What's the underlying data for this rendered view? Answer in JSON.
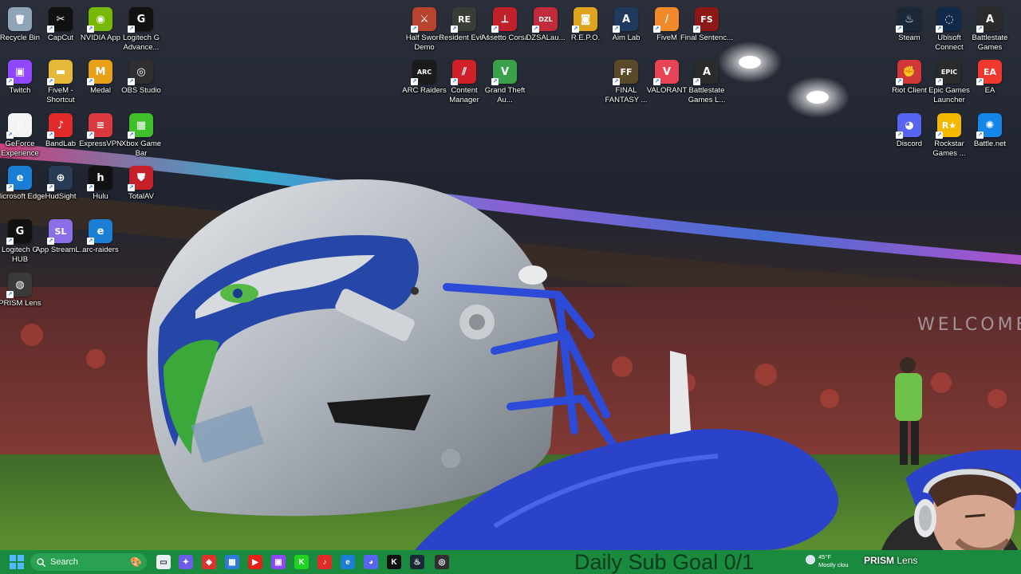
{
  "desktop": {
    "icons": [
      {
        "id": "recycle-bin",
        "label": "Recycle Bin",
        "glyph": "🗑",
        "bg": "#8fa4b8",
        "shortcut": false
      },
      {
        "id": "capcut",
        "label": "CapCut",
        "glyph": "✂",
        "bg": "#111111",
        "shortcut": true
      },
      {
        "id": "nvidia-app",
        "label": "NVIDIA App",
        "glyph": "◉",
        "bg": "#76b900",
        "shortcut": true
      },
      {
        "id": "logitech-g-advance",
        "label": "Logitech G Advance...",
        "glyph": "G",
        "bg": "#111111",
        "shortcut": true
      },
      {
        "id": "twitch",
        "label": "Twitch",
        "glyph": "▣",
        "bg": "#9146ff",
        "shortcut": true
      },
      {
        "id": "fivem-shortcut",
        "label": "FiveM - Shortcut",
        "glyph": "▬",
        "bg": "#e8b83a",
        "shortcut": true
      },
      {
        "id": "medal",
        "label": "Medal",
        "glyph": "M",
        "bg": "#e8a017",
        "shortcut": true
      },
      {
        "id": "obs-studio",
        "label": "OBS Studio",
        "glyph": "◎",
        "bg": "#302e31",
        "shortcut": true
      },
      {
        "id": "geforce-experience",
        "label": "GeForce Experience",
        "glyph": "▯",
        "bg": "#f4f4f4",
        "shortcut": true
      },
      {
        "id": "bandlab",
        "label": "BandLab",
        "glyph": "♪",
        "bg": "#e22a2a",
        "shortcut": true
      },
      {
        "id": "expressvpn",
        "label": "ExpressVPN",
        "glyph": "≡",
        "bg": "#da3940",
        "shortcut": true
      },
      {
        "id": "xbox-game-bar",
        "label": "Xbox Game Bar",
        "glyph": "▦",
        "bg": "#3fbf2a",
        "shortcut": true
      },
      {
        "id": "microsoft-edge",
        "label": "Microsoft Edge",
        "glyph": "e",
        "bg": "#1a7fd4",
        "shortcut": true
      },
      {
        "id": "hudsight",
        "label": "HudSight",
        "glyph": "⊕",
        "bg": "#2a3c55",
        "shortcut": true
      },
      {
        "id": "hulu",
        "label": "Hulu",
        "glyph": "h",
        "bg": "#111111",
        "shortcut": true
      },
      {
        "id": "totalav",
        "label": "TotalAV",
        "glyph": "⛊",
        "bg": "#c6202a",
        "shortcut": true
      },
      {
        "id": "logitech-g-hub",
        "label": "Logitech G HUB",
        "glyph": "G",
        "bg": "#111111",
        "shortcut": true
      },
      {
        "id": "app-streamlabs",
        "label": "App StreamL...",
        "glyph": "SL",
        "bg": "#8a6fe8",
        "shortcut": true
      },
      {
        "id": "arc-raiders-edge",
        "label": "arc-raiders",
        "glyph": "e",
        "bg": "#1a7fd4",
        "shortcut": true
      },
      {
        "id": "prism-lens",
        "label": "PRISM Lens",
        "glyph": "◍",
        "bg": "#3a3a3a",
        "shortcut": true
      },
      {
        "id": "half-sword-demo",
        "label": "Half Sword Demo",
        "glyph": "⚔",
        "bg": "#b9432e",
        "shortcut": true
      },
      {
        "id": "resident-evil-4",
        "label": "Resident Evil 4",
        "glyph": "RE",
        "bg": "#3a3d36",
        "shortcut": true
      },
      {
        "id": "assetto-corsa",
        "label": "Assetto Corsa",
        "glyph": "⟂",
        "bg": "#c0202a",
        "shortcut": true
      },
      {
        "id": "dzsa-launcher",
        "label": "DZSALau...",
        "glyph": "DZL",
        "bg": "#c12b3a",
        "shortcut": true
      },
      {
        "id": "repo",
        "label": "R.E.P.O.",
        "glyph": "◙",
        "bg": "#e0a31c",
        "shortcut": true
      },
      {
        "id": "aim-lab",
        "label": "Aim Lab",
        "glyph": "A",
        "bg": "#1f3a5c",
        "shortcut": true
      },
      {
        "id": "fivem",
        "label": "FiveM",
        "glyph": "/",
        "bg": "#f28a2c",
        "shortcut": true
      },
      {
        "id": "final-sentence",
        "label": "Final Sentenc...",
        "glyph": "FS",
        "bg": "#8c1818",
        "shortcut": true
      },
      {
        "id": "arc-raiders",
        "label": "ARC Raiders",
        "glyph": "ARC",
        "bg": "#1b1b1b",
        "shortcut": true
      },
      {
        "id": "content-manager",
        "label": "Content Manager",
        "glyph": "⫽",
        "bg": "#d0202a",
        "shortcut": true
      },
      {
        "id": "gta-v",
        "label": "Grand Theft Au...",
        "glyph": "V",
        "bg": "#3aa14a",
        "shortcut": true
      },
      {
        "id": "final-fantasy",
        "label": "FINAL FANTASY ...",
        "glyph": "FF",
        "bg": "#5a4a2a",
        "shortcut": true
      },
      {
        "id": "valorant",
        "label": "VALORANT",
        "glyph": "V",
        "bg": "#e84456",
        "shortcut": true
      },
      {
        "id": "battlestate-games-launcher",
        "label": "Battlestate Games L...",
        "glyph": "A",
        "bg": "#2b2b2b",
        "shortcut": true
      },
      {
        "id": "steam",
        "label": "Steam",
        "glyph": "♨",
        "bg": "#1b2838",
        "shortcut": true
      },
      {
        "id": "ubisoft-connect",
        "label": "Ubisoft Connect",
        "glyph": "◌",
        "bg": "#0f2a4a",
        "shortcut": true
      },
      {
        "id": "battlestate-games",
        "label": "Battlestate Games",
        "glyph": "A",
        "bg": "#2b2b2b",
        "shortcut": true
      },
      {
        "id": "riot-client",
        "label": "Riot Client",
        "glyph": "✊",
        "bg": "#d13639",
        "shortcut": true
      },
      {
        "id": "epic-games-launcher",
        "label": "Epic Games Launcher",
        "glyph": "EPIC",
        "bg": "#2a2a2a",
        "shortcut": true
      },
      {
        "id": "ea",
        "label": "EA",
        "glyph": "EA",
        "bg": "#f0382e",
        "shortcut": true
      },
      {
        "id": "discord",
        "label": "Discord",
        "glyph": "◕",
        "bg": "#5865f2",
        "shortcut": true
      },
      {
        "id": "rockstar-games",
        "label": "Rockstar Games ...",
        "glyph": "R★",
        "bg": "#f5b800",
        "shortcut": true
      },
      {
        "id": "battle-net",
        "label": "Battle.net",
        "glyph": "✺",
        "bg": "#1386e8",
        "shortcut": true
      }
    ]
  },
  "taskbar": {
    "search_placeholder": "Search",
    "apps": [
      {
        "id": "task-view",
        "glyph": "▭",
        "bg": "#e9eef3"
      },
      {
        "id": "copilot",
        "glyph": "✦",
        "bg": "#6c5ce7"
      },
      {
        "id": "app-red-diamond",
        "glyph": "◆",
        "bg": "#e03131"
      },
      {
        "id": "microsoft-store",
        "glyph": "▦",
        "bg": "#2f7ad8"
      },
      {
        "id": "youtube",
        "glyph": "▶",
        "bg": "#e62117"
      },
      {
        "id": "twitch",
        "glyph": "▣",
        "bg": "#9146ff"
      },
      {
        "id": "kick",
        "glyph": "K",
        "bg": "#20d320"
      },
      {
        "id": "bandlab",
        "glyph": "♪",
        "bg": "#e22a2a"
      },
      {
        "id": "edge",
        "glyph": "e",
        "bg": "#1a7fd4"
      },
      {
        "id": "discord",
        "glyph": "◕",
        "bg": "#5865f2"
      },
      {
        "id": "kick-studio",
        "glyph": "K",
        "bg": "#111111"
      },
      {
        "id": "steam",
        "glyph": "♨",
        "bg": "#1b2838"
      },
      {
        "id": "obs",
        "glyph": "◎",
        "bg": "#302e31"
      }
    ],
    "sub_goal_text": "Daily Sub Goal 0/1",
    "weather": {
      "temp": "45°F",
      "condition": "Mostly clou"
    }
  },
  "overlay": {
    "watermark_brand": "PRISM",
    "watermark_product": "Lens"
  }
}
